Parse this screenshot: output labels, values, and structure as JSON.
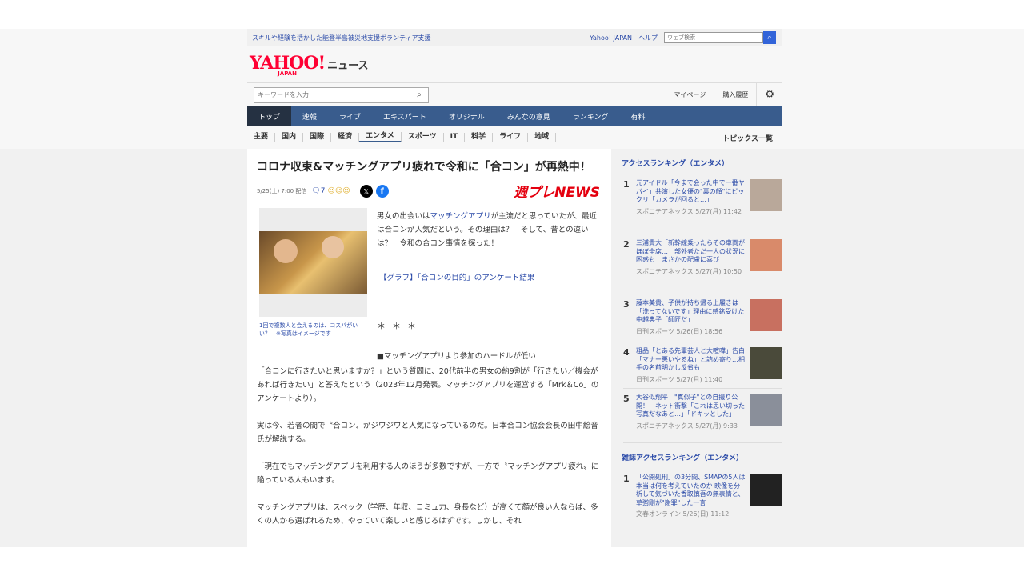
{
  "util": {
    "promo": "スキルや経験を活かした能登半島被災地支援ボランティア支援",
    "yahoo_japan": "Yahoo! JAPAN",
    "help": "ヘルプ",
    "search_placeholder": "ウェブ検索"
  },
  "logo": {
    "yahoo": "YAHOO!",
    "japan": "JAPAN",
    "news": "ニュース"
  },
  "searchbar": {
    "placeholder": "キーワードを入力",
    "mypage": "マイページ",
    "history": "購入履歴"
  },
  "nav": [
    "トップ",
    "速報",
    "ライブ",
    "エキスパート",
    "オリジナル",
    "みんなの意見",
    "ランキング",
    "有料"
  ],
  "subnav": [
    "主要",
    "国内",
    "国際",
    "経済",
    "エンタメ",
    "スポーツ",
    "IT",
    "科学",
    "ライフ",
    "地域"
  ],
  "subnav_all": "トピックス一覧",
  "article": {
    "title": "コロナ収束&マッチングアプリ疲れで令和に「合コン」が再熱中！",
    "date": "5/25(土) 7:00 配信",
    "comments": "7",
    "publisher": "週プレNEWS",
    "lead_1": "男女の出会いは",
    "lead_link": "マッチングアプリ",
    "lead_2": "が主流だと思っていたが、最近は合コンが人気だという。その理由は？　そして、昔との違いは？　令和の合コン事情を探った！",
    "graph_link": "【グラフ】「合コンの目的」のアンケート結果",
    "caption": "1回で複数人と会えるのは、コスパがいい？　※写真はイメージです",
    "stars": "＊＊＊",
    "heading": "■マッチングアプリより参加のハードルが低い",
    "paragraphs": [
      "「合コンに行きたいと思いますか？」という質問に、20代前半の男女の約9割が「行きたい／機会があれば行きたい」と答えたという（2023年12月発表。マッチングアプリを運営する「Mrk＆Co」のアンケートより）。",
      "実は今、若者の間で〝合コン〟がジワジワと人気になっているのだ。日本合コン協会会長の田中絵音氏が解説する。",
      "「現在でもマッチングアプリを利用する人のほうが多数ですが、一方で〝マッチングアプリ疲れ〟に陥っている人もいます。",
      "マッチングアプリは、スペック（学歴、年収、コミュ力、身長など）が高くて顔が良い人ならば、多くの人から選ばれるため、やっていて楽しいと感じるはずです。しかし、それ"
    ]
  },
  "ranking": {
    "title": "アクセスランキング（エンタメ）",
    "items": [
      {
        "n": "1",
        "text": "元アイドル「今まで会った中で一番ヤバイ」共演した女優の\"裏の顔\"にビックリ「カメラが回ると…」",
        "src": "スポニチアネックス 5/27(月) 11:42"
      },
      {
        "n": "2",
        "text": "三浦貴大「新幹線乗ったらその車両がほぼ全席…」部外者ただ一人の状況に困惑も　まさかの配慮に喜び",
        "src": "スポニチアネックス 5/27(月) 10:50"
      },
      {
        "n": "3",
        "text": "藤本美貴、子供が持ち帰る上履きは「洗ってないです」理由に感銘受けた中越典子「師匠だ」",
        "src": "日刊スポーツ 5/26(日) 18:56"
      },
      {
        "n": "4",
        "text": "粗品「とある先輩芸人と大喧嘩」告白「マナー悪いやるね」と詰め寄り…相手の名前明かし反省も",
        "src": "日刊スポーツ 5/27(月) 11:40"
      },
      {
        "n": "5",
        "text": "大谷似翔平　\"真似子\"との自撮り公開！　ネット衝撃「これは思い切った写真だなあと…」「ドキッとした」",
        "src": "スポニチアネックス 5/27(月) 9:33"
      }
    ]
  },
  "magazine": {
    "title": "雑誌アクセスランキング（エンタメ）",
    "items": [
      {
        "n": "1",
        "text": "「公開処刑」の3分間、SMAPの5人は本当は何を考えていたのか 映像を分析して気づいた香取慎吾の無表情と、草彅剛が\"謝罪\"した一言",
        "src": "文春オンライン 5/26(日) 11:12"
      }
    ]
  }
}
